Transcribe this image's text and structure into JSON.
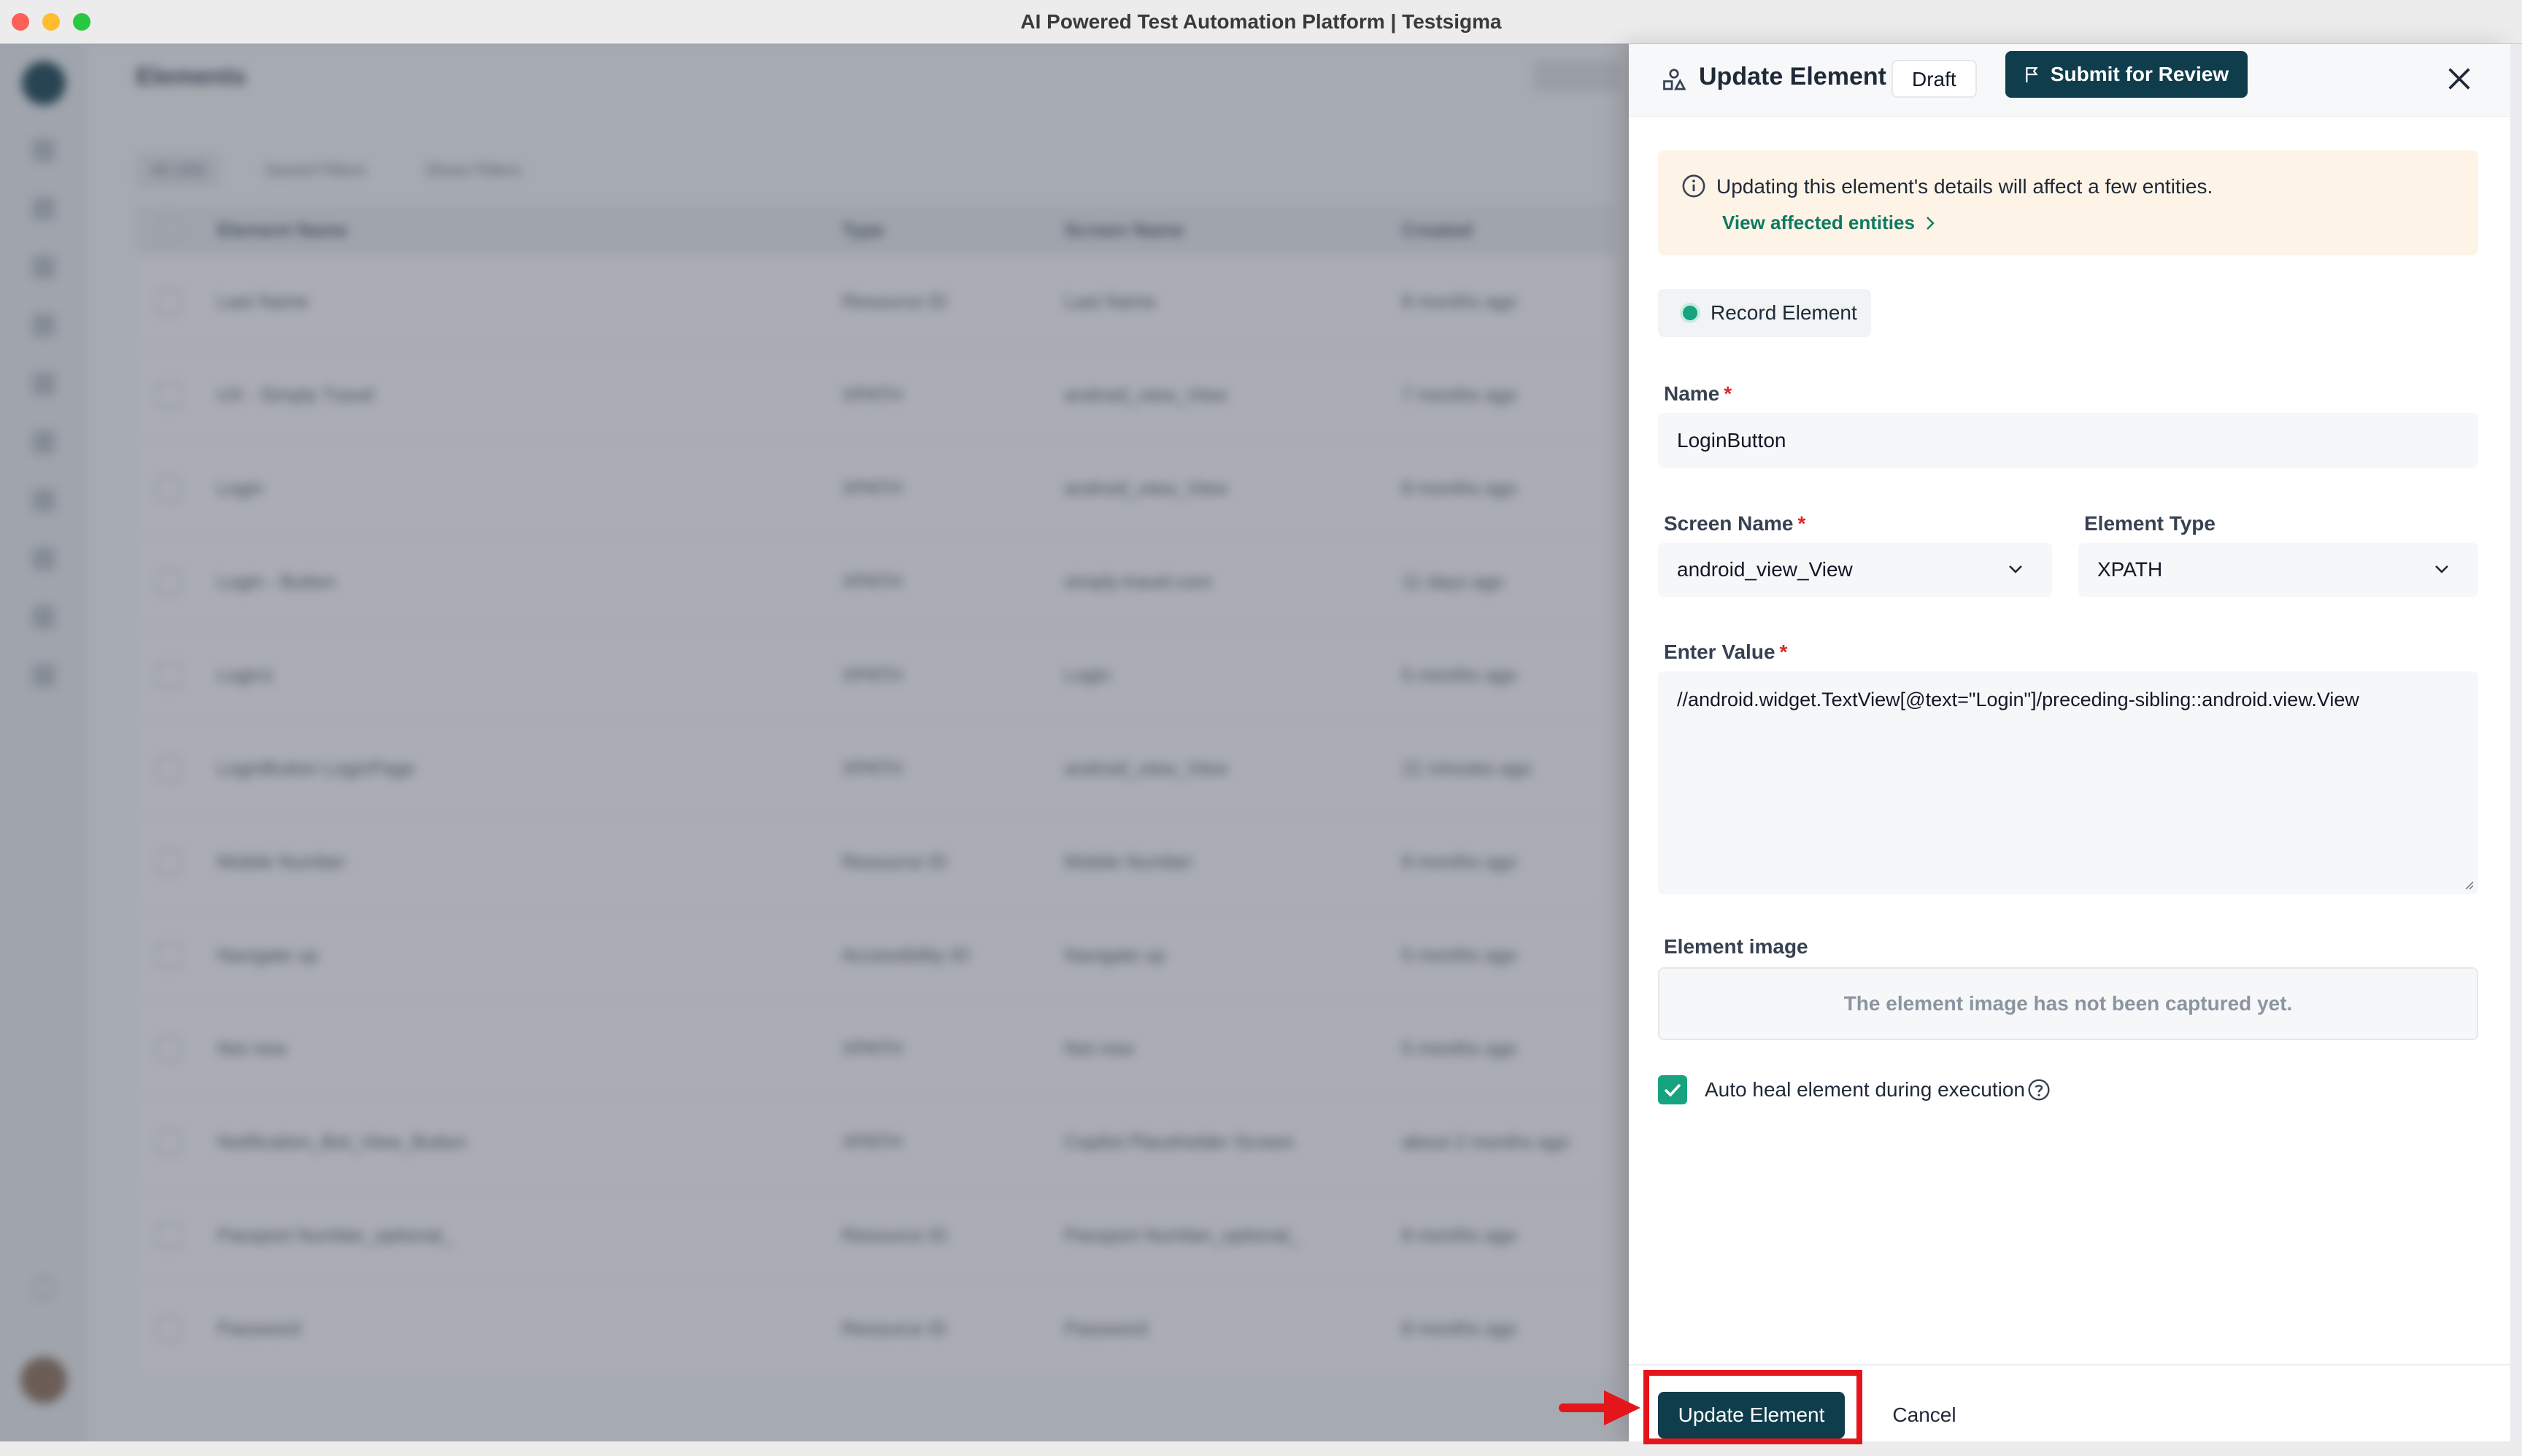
{
  "window": {
    "title": "AI Powered Test Automation Platform | Testsigma"
  },
  "background": {
    "page_title": "Elements",
    "filters": [
      "All (59)",
      "Saved Filters",
      "Show Filters"
    ],
    "columns": [
      "Element Name",
      "Type",
      "Screen Name",
      "Created"
    ],
    "rows": [
      [
        "Last Name",
        "Resource ID",
        "Last Name",
        "8 months ago"
      ],
      [
        "UX - Simply Travel",
        "XPATH",
        "android_view_View",
        "7 months ago"
      ],
      [
        "Login",
        "XPATH",
        "android_view_View",
        "8 months ago"
      ],
      [
        "Login - Button",
        "XPATH",
        "simply-travel.com",
        "11 days ago"
      ],
      [
        "Login1",
        "XPATH",
        "Login",
        "5 months ago"
      ],
      [
        "LoginButton LoginPage",
        "XPATH",
        "android_view_View",
        "21 minutes ago"
      ],
      [
        "Mobile Number",
        "Resource ID",
        "Mobile Number",
        "8 months ago"
      ],
      [
        "Navigate up",
        "Accessibility ID",
        "Navigate up",
        "5 months ago"
      ],
      [
        "Not now",
        "XPATH",
        "Not now",
        "5 months ago"
      ],
      [
        "Notification_Bot_View_Button",
        "XPATH",
        "Copilot Placeholder Screen",
        "about 2 months ago"
      ],
      [
        "Passport Number_optional_",
        "Resource ID",
        "Passport Number_optional_",
        "8 months ago"
      ],
      [
        "Password",
        "Resource ID",
        "Password",
        "8 months ago"
      ]
    ]
  },
  "drawer": {
    "title": "Update Element",
    "status_badge": "Draft",
    "submit_label": "Submit for Review",
    "notice": {
      "text": "Updating this element's details will affect a few entities.",
      "link": "View affected entities"
    },
    "record_label": "Record Element",
    "name": {
      "label": "Name",
      "value": "LoginButton"
    },
    "screen_name": {
      "label": "Screen Name",
      "value": "android_view_View"
    },
    "element_type": {
      "label": "Element Type",
      "value": "XPATH"
    },
    "enter_value": {
      "label": "Enter Value",
      "value": "//android.widget.TextView[@text=\"Login\"]/preceding-sibling::android.view.View"
    },
    "element_image": {
      "label": "Element image",
      "placeholder": "The element image has not been captured yet."
    },
    "auto_heal": {
      "label": "Auto heal element during execution",
      "checked": true
    },
    "update_label": "Update Element",
    "cancel_label": "Cancel"
  },
  "colors": {
    "primary": "#0f3d4c",
    "accent_green": "#16a37f",
    "notice_bg": "#fdf4e7",
    "annotation_red": "#e5161b"
  },
  "icons": [
    "element-icon",
    "flag-icon",
    "close-icon",
    "info-icon",
    "chevron-right-icon",
    "chevron-down-icon",
    "checkmark-icon",
    "help-icon",
    "arrow-right-icon"
  ]
}
